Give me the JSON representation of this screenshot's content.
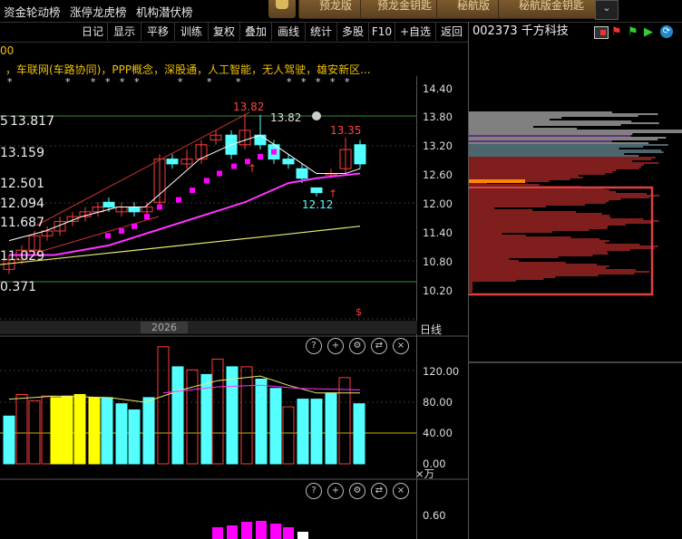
{
  "top_links": [
    "资金轮动榜",
    "涨停龙虎榜",
    "机构潜伏榜"
  ],
  "top_buttons": [
    "预龙版",
    "预龙金钥匙",
    "秘航版",
    "秘航版金钥匙"
  ],
  "menu": [
    "日记",
    "显示",
    "平移",
    "训练",
    "复权",
    "叠加",
    "画线",
    "统计",
    "多股",
    "F10",
    "+自选",
    "返回"
  ],
  "stock": {
    "code": "002373",
    "name": "千方科技"
  },
  "concepts_prefix": "00",
  "concepts": "，车联网(车路协同)，PPP概念，深股通，人工智能，无人驾驶，雄安新区...",
  "price_axis": [
    "14.40",
    "13.80",
    "13.20",
    "12.60",
    "12.00",
    "11.40",
    "10.80",
    "10.20"
  ],
  "left_levels": [
    "13.817",
    "13.159",
    "12.501",
    "12.094",
    "11.687",
    "11.029",
    "0.371"
  ],
  "left_prefix": "5",
  "annotations": {
    "high": "13.82",
    "high2": "13.82",
    "recent_high": "13.35",
    "low": "12.12"
  },
  "year_label": "2026",
  "period_label": "日线",
  "volume_axis": [
    "120.00",
    "80.00",
    "40.00",
    "0.00"
  ],
  "volume_unit": "×万",
  "indicator_axis": [
    "0.60"
  ],
  "colors": {
    "up": "#ff3b3b",
    "down": "#54ffff",
    "ma5": "#ffffff",
    "ma10": "#ffff00",
    "ma20": "#ff00ff",
    "ma60": "#e8e870",
    "accent": "#f0c000"
  }
}
